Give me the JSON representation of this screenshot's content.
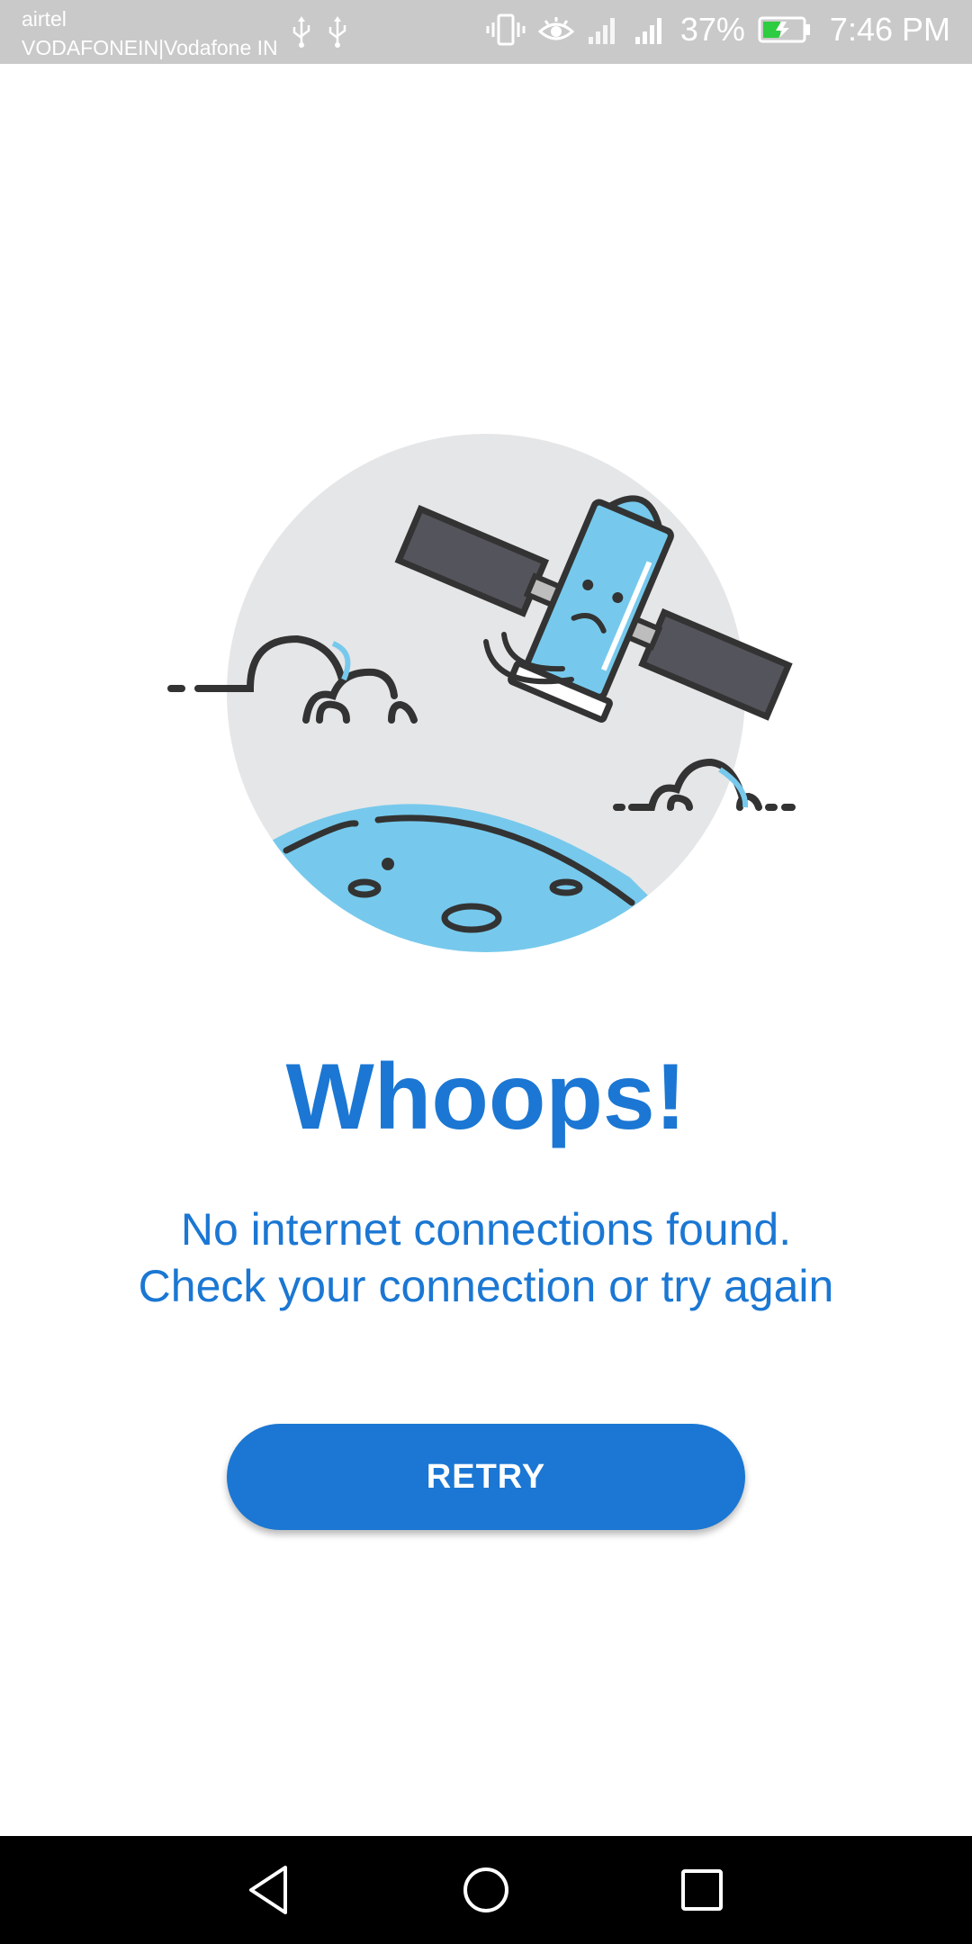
{
  "status_bar": {
    "carrier_primary": "airtel",
    "carrier_secondary": "VODAFONEIN|Vodafone IN",
    "battery_percent": "37%",
    "time": "7:46 PM",
    "icons": [
      "usb-icon",
      "usb-icon",
      "vibrate-icon",
      "eye-icon",
      "signal-icon",
      "signal-icon",
      "battery-charging-icon"
    ]
  },
  "illustration": {
    "subject": "satellite-over-planet",
    "colors": {
      "circle": "#e5e6e8",
      "accent_blue": "#76c9ec",
      "outline": "#333333",
      "panel": "#54545c"
    }
  },
  "error": {
    "title": "Whoops!",
    "message_line1": "No internet connections found.",
    "message_line2": "Check your connection or try again"
  },
  "actions": {
    "retry_label": "RETRY"
  },
  "nav_bar": {
    "items": [
      "back-icon",
      "home-icon",
      "recents-icon"
    ]
  },
  "theme": {
    "accent": "#1b77d3",
    "status_bar_bg": "#c9c9c9",
    "nav_bg": "#000000"
  }
}
